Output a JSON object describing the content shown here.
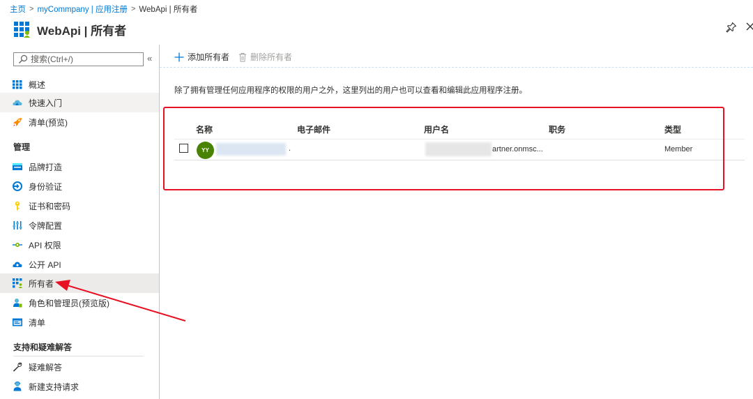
{
  "breadcrumb": {
    "items": [
      "主页",
      "myCommpany | 应用注册",
      "WebApi | 所有者"
    ],
    "separator": ">"
  },
  "header": {
    "title": "WebApi | 所有者",
    "icons": [
      "app-registration-icon",
      "pin-icon",
      "close-icon"
    ]
  },
  "sidebar": {
    "search_placeholder": "搜索(Ctrl+/)",
    "collapse_glyph": "«",
    "top_items": [
      {
        "label": "概述",
        "icon": "overview-grid-icon"
      },
      {
        "label": "快速入门",
        "icon": "cloud-icon"
      },
      {
        "label": "清单(预览)",
        "icon": "rocket-icon"
      }
    ],
    "section_manage": "管理",
    "manage_items": [
      {
        "label": "品牌打造",
        "icon": "branding-icon"
      },
      {
        "label": "身份验证",
        "icon": "authentication-icon"
      },
      {
        "label": "证书和密码",
        "icon": "key-icon"
      },
      {
        "label": "令牌配置",
        "icon": "token-config-icon"
      },
      {
        "label": "API 权限",
        "icon": "api-permissions-icon"
      },
      {
        "label": "公开 API",
        "icon": "expose-api-cloud-icon"
      },
      {
        "label": "所有者",
        "icon": "owners-grid-icon"
      },
      {
        "label": "角色和管理员(预览版)",
        "icon": "roles-admin-icon"
      },
      {
        "label": "清单",
        "icon": "manifest-icon"
      }
    ],
    "section_support": "支持和疑难解答",
    "support_items": [
      {
        "label": "疑难解答",
        "icon": "wrench-icon"
      },
      {
        "label": "新建支持请求",
        "icon": "support-person-icon"
      }
    ]
  },
  "toolbar": {
    "add_owner": "添加所有者",
    "remove_owner": "删除所有者"
  },
  "description": "除了拥有管理任何应用程序的权限的用户之外，这里列出的用户也可以查看和编辑此应用程序注册。",
  "owners_table": {
    "columns": [
      "名称",
      "电子邮件",
      "用户名",
      "职务",
      "类型"
    ],
    "rows": [
      {
        "avatar_initials": "YY",
        "email_visible": ".",
        "username_visible": "artner.onmsc...",
        "job_title": "",
        "type": "Member"
      }
    ]
  },
  "colors": {
    "accent": "#0078d4",
    "avatar_bg": "#498205",
    "highlight_red": "#e81123",
    "active_nav_bg": "#edebe9"
  }
}
